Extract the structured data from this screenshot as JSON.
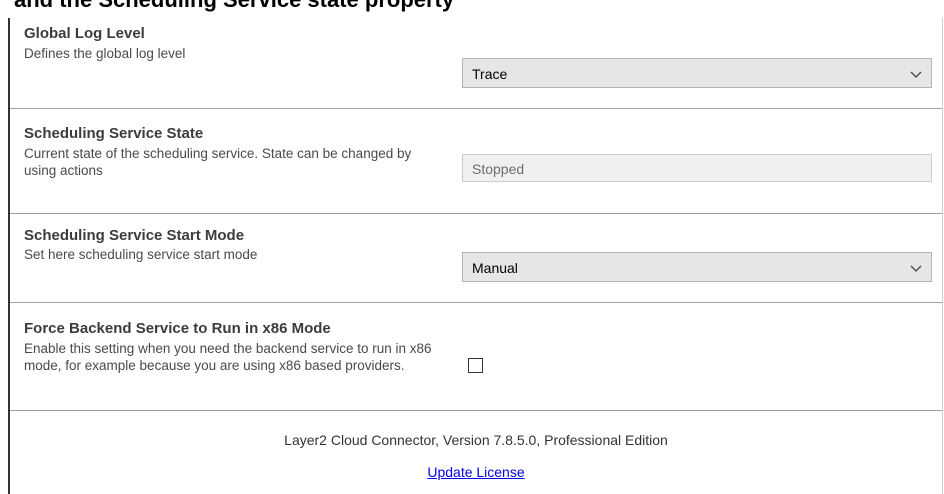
{
  "top_heading": "and the Scheduling Service state property",
  "settings": [
    {
      "title": "Global Log Level",
      "description": "Defines the global log level",
      "control": "dropdown",
      "value": "Trace"
    },
    {
      "title": "Scheduling Service State",
      "description": "Current state of the scheduling service. State can be changed by using actions",
      "control": "readonly-text",
      "value": "Stopped"
    },
    {
      "title": "Scheduling Service Start Mode",
      "description": "Set here scheduling service start mode",
      "control": "dropdown",
      "value": "Manual"
    },
    {
      "title": "Force Backend Service to Run in x86 Mode",
      "description": "Enable this setting when you need the backend service to run in x86 mode, for example because you are using x86 based providers.",
      "control": "checkbox",
      "checked": false
    }
  ],
  "footer": {
    "version_text": "Layer2 Cloud Connector, Version 7.8.5.0, Professional Edition",
    "link_label": "Update License",
    "link_color": "#0000ee"
  },
  "icons": {
    "dropdown_arrow": "chevron-down-icon"
  }
}
